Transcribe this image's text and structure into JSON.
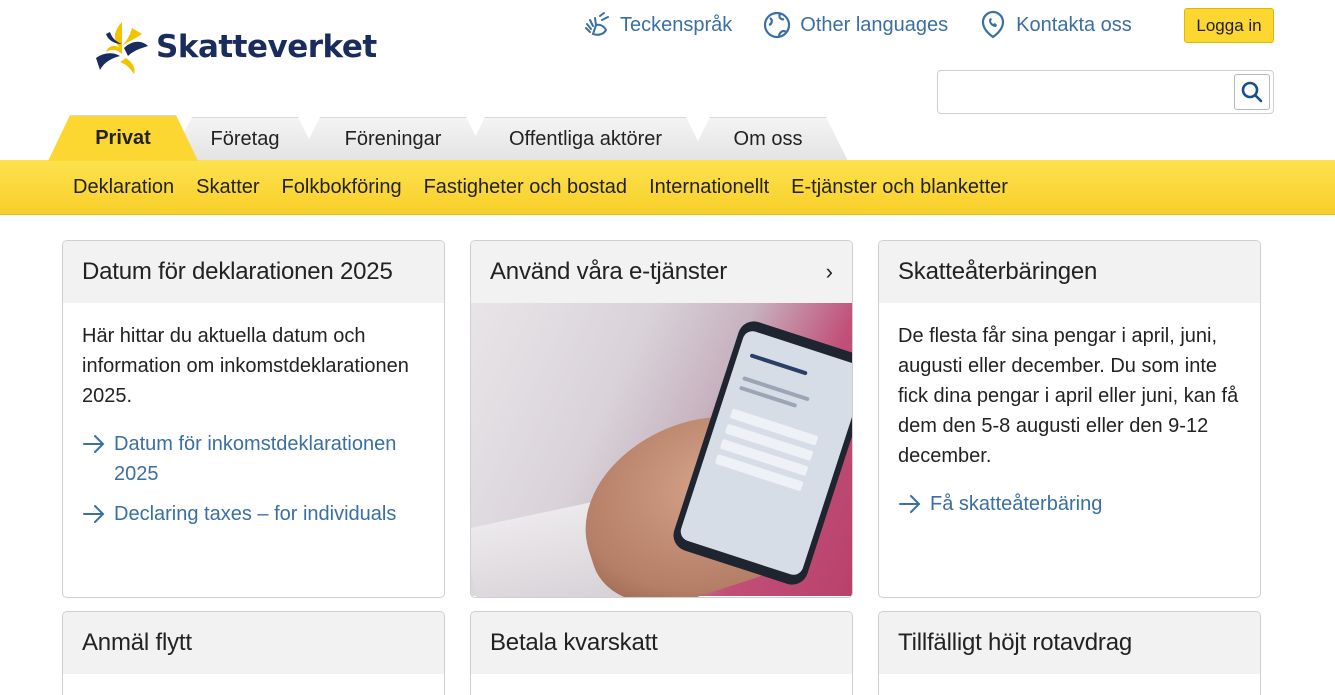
{
  "header": {
    "logo_text": "Skatteverket",
    "links": [
      {
        "label": "Teckenspråk",
        "icon": "sign-language-icon"
      },
      {
        "label": "Other languages",
        "icon": "globe-icon"
      },
      {
        "label": "Kontakta oss",
        "icon": "contact-icon"
      }
    ],
    "login_label": "Logga in",
    "search_placeholder": ""
  },
  "tabs": [
    {
      "label": "Privat",
      "active": true
    },
    {
      "label": "Företag",
      "active": false
    },
    {
      "label": "Föreningar",
      "active": false
    },
    {
      "label": "Offentliga aktörer",
      "active": false
    },
    {
      "label": "Om oss",
      "active": false
    }
  ],
  "subnav": [
    "Deklaration",
    "Skatter",
    "Folkbokföring",
    "Fastigheter och bostad",
    "Internationellt",
    "E-tjänster och blanketter"
  ],
  "cards": [
    {
      "title": "Datum för deklarationen 2025",
      "text": "Här hittar du aktuella datum och information om inkomstdeklarationen 2025.",
      "links": [
        "Datum för inkomstdeklarationen 2025",
        "Declaring taxes – for individuals"
      ]
    },
    {
      "title": "Använd våra e-tjänster",
      "chevron": "›"
    },
    {
      "title": "Skatteåterbäringen",
      "text": "De flesta får sina pengar i april, juni, augusti eller december. Du som inte fick dina pengar i april eller juni, kan få dem den 5-8 augusti eller den 9-12 december.",
      "links": [
        "Få skatteåterbäring"
      ]
    },
    {
      "title": "Anmäl flytt"
    },
    {
      "title": "Betala kvarskatt"
    },
    {
      "title": "Tillfälligt höjt rotavdrag"
    }
  ],
  "colors": {
    "accent_yellow": "#fcd731",
    "link_blue": "#3a6fa3",
    "logo_navy": "#1a2c5e"
  }
}
